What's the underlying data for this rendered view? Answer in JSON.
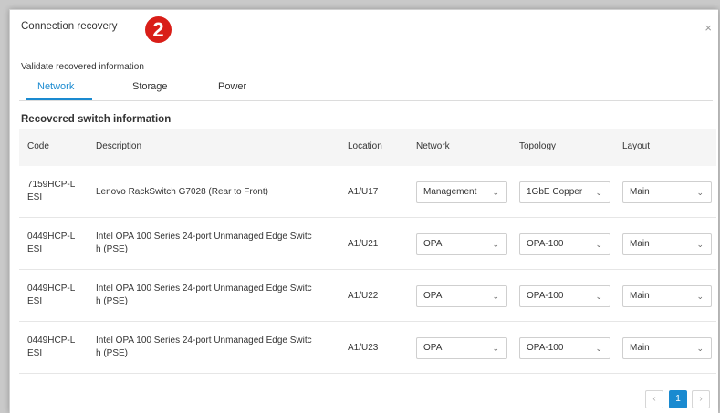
{
  "dialog": {
    "title": "Connection recovery",
    "step_badge": "2",
    "close_glyph": "×",
    "subtitle": "Validate recovered information"
  },
  "tabs": [
    {
      "label": "Network",
      "active": true
    },
    {
      "label": "Storage",
      "active": false
    },
    {
      "label": "Power",
      "active": false
    }
  ],
  "section_title": "Recovered switch information",
  "table": {
    "headers": [
      "Code",
      "Description",
      "Location",
      "Network",
      "Topology",
      "Layout"
    ],
    "rows": [
      {
        "code_l1": "7159HCP-L",
        "code_l2": "ESI",
        "desc_l1": "Lenovo RackSwitch G7028 (Rear to Front)",
        "desc_l2": "",
        "location": "A1/U17",
        "network": "Management",
        "topology": "1GbE Copper",
        "layout": "Main"
      },
      {
        "code_l1": "0449HCP-L",
        "code_l2": "ESI",
        "desc_l1": "Intel OPA 100 Series 24-port Unmanaged Edge Switc",
        "desc_l2": "h (PSE)",
        "location": "A1/U21",
        "network": "OPA",
        "topology": "OPA-100",
        "layout": "Main"
      },
      {
        "code_l1": "0449HCP-L",
        "code_l2": "ESI",
        "desc_l1": "Intel OPA 100 Series 24-port Unmanaged Edge Switc",
        "desc_l2": "h (PSE)",
        "location": "A1/U22",
        "network": "OPA",
        "topology": "OPA-100",
        "layout": "Main"
      },
      {
        "code_l1": "0449HCP-L",
        "code_l2": "ESI",
        "desc_l1": "Intel OPA 100 Series 24-port Unmanaged Edge Switc",
        "desc_l2": "h (PSE)",
        "location": "A1/U23",
        "network": "OPA",
        "topology": "OPA-100",
        "layout": "Main"
      }
    ]
  },
  "select_chevron": "⌄",
  "pagination": {
    "prev": "‹",
    "current": "1",
    "next": "›"
  },
  "colors": {
    "accent": "#1a8ad0",
    "badge": "#d91e18"
  }
}
